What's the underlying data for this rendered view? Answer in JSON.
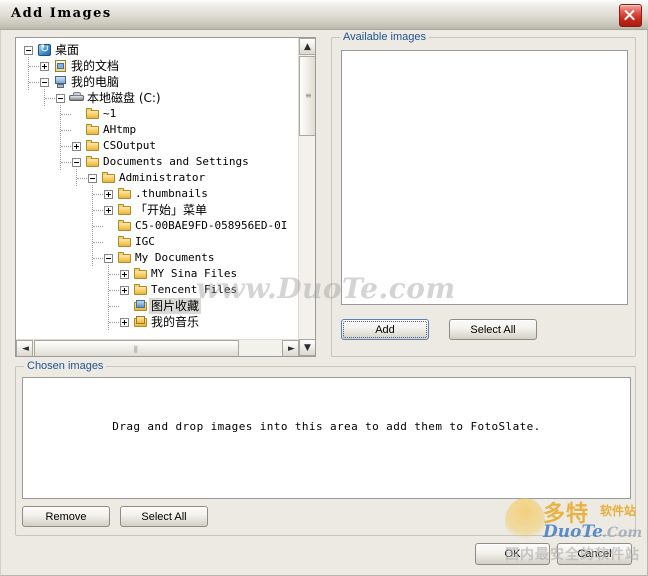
{
  "window": {
    "title": "Add Images",
    "close_icon": "close-icon"
  },
  "tree": {
    "nodes": [
      {
        "label": "桌面",
        "depth": 0,
        "expander": "minus",
        "icon": "desktop-icon",
        "cjk": true,
        "selected": false
      },
      {
        "label": "我的文档",
        "depth": 1,
        "expander": "plus",
        "icon": "mydocs-icon",
        "cjk": true,
        "selected": false
      },
      {
        "label": "我的电脑",
        "depth": 1,
        "expander": "minus",
        "icon": "mycomputer-icon",
        "cjk": true,
        "selected": false
      },
      {
        "label": "本地磁盘 (C:)",
        "depth": 2,
        "expander": "minus",
        "icon": "drive-icon",
        "cjk": true,
        "selected": false
      },
      {
        "label": "~1",
        "depth": 3,
        "expander": "none",
        "icon": "folder-icon",
        "cjk": false,
        "selected": false
      },
      {
        "label": "AHtmp",
        "depth": 3,
        "expander": "none",
        "icon": "folder-icon",
        "cjk": false,
        "selected": false
      },
      {
        "label": "CSOutput",
        "depth": 3,
        "expander": "plus",
        "icon": "folder-icon",
        "cjk": false,
        "selected": false
      },
      {
        "label": "Documents and Settings",
        "depth": 3,
        "expander": "minus",
        "icon": "folder-icon",
        "cjk": false,
        "selected": false
      },
      {
        "label": "Administrator",
        "depth": 4,
        "expander": "minus",
        "icon": "folder-icon",
        "cjk": false,
        "selected": false
      },
      {
        "label": ".thumbnails",
        "depth": 5,
        "expander": "plus",
        "icon": "folder-icon",
        "cjk": false,
        "selected": false
      },
      {
        "label": "「开始」菜单",
        "depth": 5,
        "expander": "plus",
        "icon": "folder-icon",
        "cjk": true,
        "selected": false
      },
      {
        "label": "C5-00BAE9FD-058956ED-0I",
        "depth": 5,
        "expander": "none",
        "icon": "folder-icon",
        "cjk": false,
        "selected": false
      },
      {
        "label": "IGC",
        "depth": 5,
        "expander": "none",
        "icon": "folder-icon",
        "cjk": false,
        "selected": false
      },
      {
        "label": "My Documents",
        "depth": 5,
        "expander": "minus",
        "icon": "folder-icon",
        "cjk": false,
        "selected": false
      },
      {
        "label": "MY Sina Files",
        "depth": 6,
        "expander": "plus",
        "icon": "folder-icon",
        "cjk": false,
        "selected": false
      },
      {
        "label": "Tencent Files",
        "depth": 6,
        "expander": "plus",
        "icon": "folder-icon",
        "cjk": false,
        "selected": false
      },
      {
        "label": "图片收藏",
        "depth": 6,
        "expander": "none",
        "icon": "folder-image-icon",
        "cjk": true,
        "selected": true
      },
      {
        "label": "我的音乐",
        "depth": 6,
        "expander": "plus",
        "icon": "folder-music-icon",
        "cjk": true,
        "selected": false
      }
    ],
    "vscroll": {
      "up_arrow": "▲",
      "down_arrow": "▼",
      "grip": "≡"
    },
    "hscroll": {
      "left_arrow": "◄",
      "right_arrow": "►",
      "grip": "⫼"
    }
  },
  "available": {
    "title": "Available images",
    "add_label": "Add",
    "select_all_label": "Select All"
  },
  "chosen": {
    "title": "Chosen images",
    "drop_hint": "Drag and drop images into this area to add them to FotoSlate.",
    "remove_label": "Remove",
    "select_all_label": "Select All"
  },
  "footer": {
    "ok_label": "OK",
    "cancel_label": "Cancel"
  },
  "watermark": {
    "site": "www.DuoTe.com",
    "logo_cn": "多特",
    "logo_cn_small": "软件站",
    "logo_duo": "DuoTe",
    "logo_com": ".Com",
    "tagline_cn": "国内最安全的软件站"
  },
  "colors": {
    "accent": "#24528f",
    "close": "#c4261a",
    "dialog_bg": "#eceae3",
    "selection": "#d8d8d4"
  }
}
